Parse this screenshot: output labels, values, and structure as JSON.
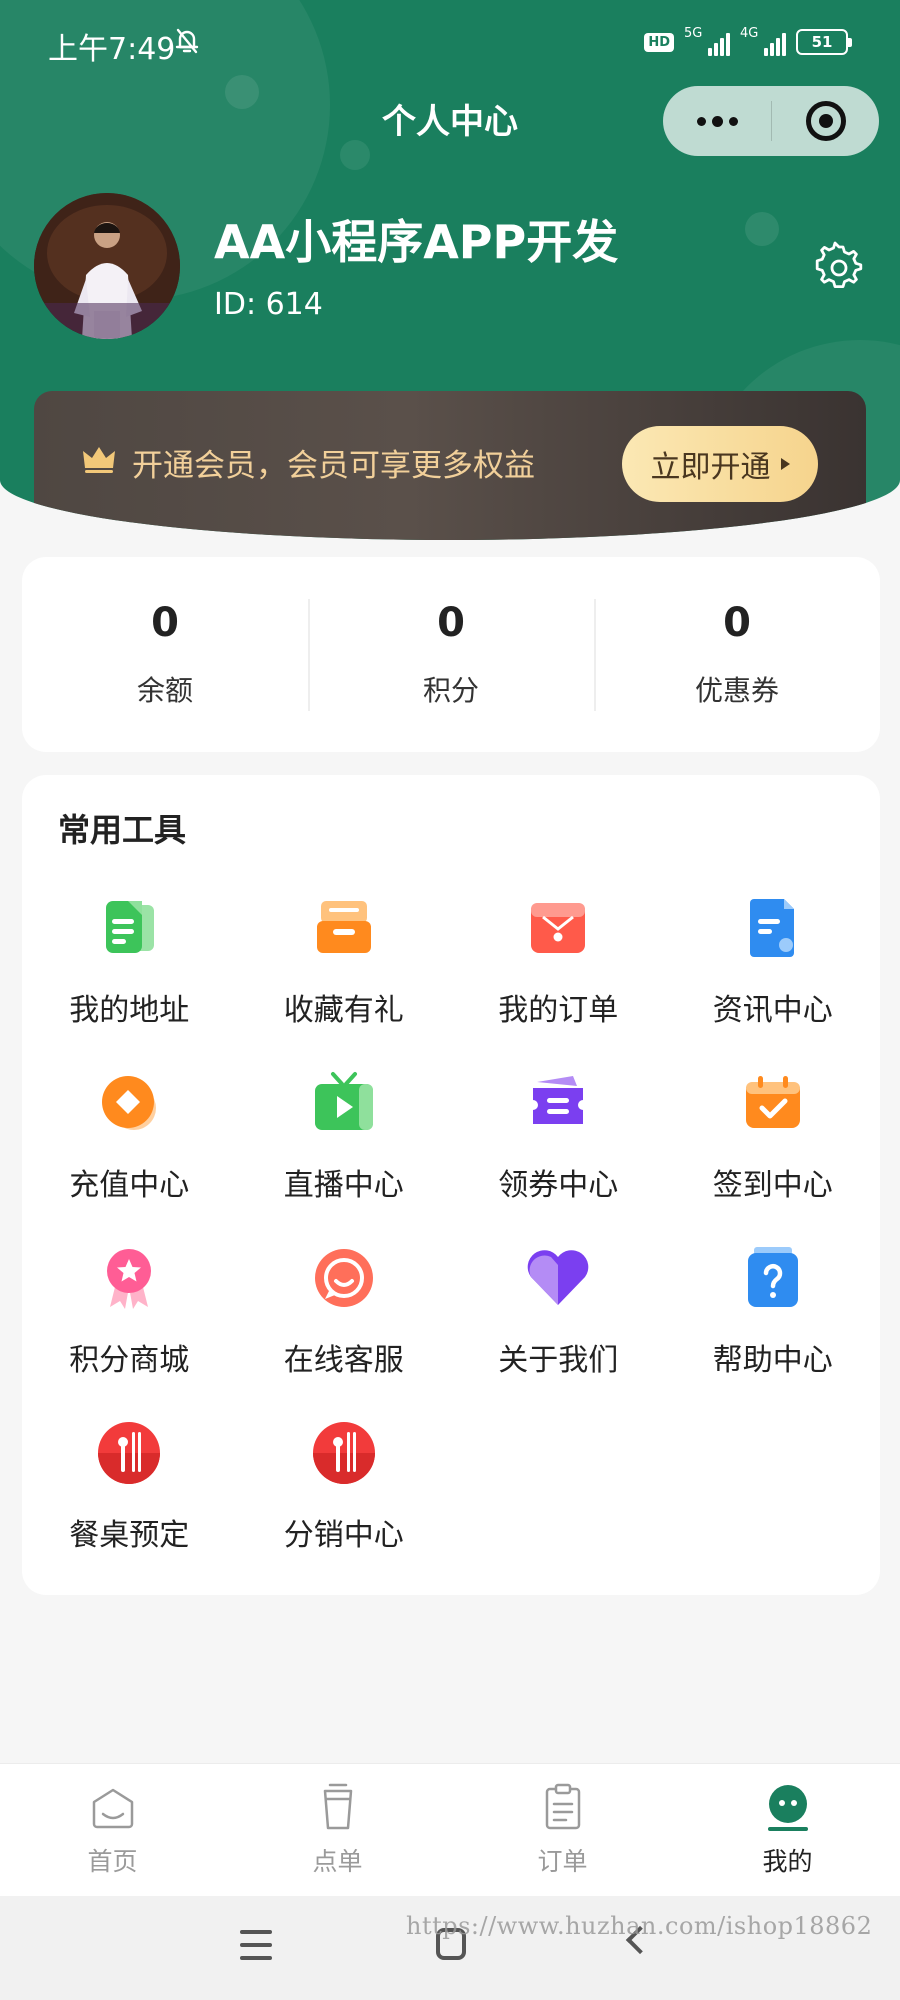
{
  "status_bar": {
    "time": "上午7:49",
    "hd": "HD",
    "net1": "5G",
    "net2": "4G",
    "battery": "51",
    "icons": [
      "bell-off-icon",
      "signal-icon",
      "battery-icon"
    ]
  },
  "nav": {
    "title": "个人中心",
    "icons": [
      "more-icon",
      "close-miniprogram-icon"
    ]
  },
  "user": {
    "name": "AA小程序APP开发",
    "id_text": "ID: 614",
    "icons": [
      "avatar-photo",
      "settings-gear-icon"
    ]
  },
  "vip": {
    "text": "开通会员，会员可享更多权益",
    "button": "立即开通",
    "icon": "crown-icon"
  },
  "stats": [
    {
      "value": "0",
      "label": "余额"
    },
    {
      "value": "0",
      "label": "积分"
    },
    {
      "value": "0",
      "label": "优惠券"
    }
  ],
  "tools": {
    "title": "常用工具",
    "items": [
      {
        "label": "我的地址",
        "icon": "address-book-icon"
      },
      {
        "label": "收藏有礼",
        "icon": "favorites-box-icon"
      },
      {
        "label": "我的订单",
        "icon": "order-wallet-icon"
      },
      {
        "label": "资讯中心",
        "icon": "news-document-icon"
      },
      {
        "label": "充值中心",
        "icon": "recharge-coin-icon"
      },
      {
        "label": "直播中心",
        "icon": "live-tv-icon"
      },
      {
        "label": "领券中心",
        "icon": "coupon-ticket-icon"
      },
      {
        "label": "签到中心",
        "icon": "checkin-calendar-icon"
      },
      {
        "label": "积分商城",
        "icon": "points-badge-icon"
      },
      {
        "label": "在线客服",
        "icon": "customer-service-chat-icon"
      },
      {
        "label": "关于我们",
        "icon": "heart-icon"
      },
      {
        "label": "帮助中心",
        "icon": "help-question-icon"
      },
      {
        "label": "餐桌预定",
        "icon": "dining-utensils-icon"
      },
      {
        "label": "分销中心",
        "icon": "distribution-utensils-icon"
      }
    ]
  },
  "tabbar": [
    {
      "label": "首页",
      "icon": "home-icon",
      "active": false
    },
    {
      "label": "点单",
      "icon": "cup-icon",
      "active": false
    },
    {
      "label": "订单",
      "icon": "clipboard-icon",
      "active": false
    },
    {
      "label": "我的",
      "icon": "profile-face-icon",
      "active": true
    }
  ],
  "system_nav": {
    "watermark": "https://www.huzhan.com/ishop18862",
    "icons": [
      "menu-icon",
      "home-square-icon",
      "back-icon"
    ]
  },
  "colors": {
    "primary_green": "#1a7f5e",
    "vip_gold": "#f2d09a",
    "background": "#f6f6f6"
  }
}
